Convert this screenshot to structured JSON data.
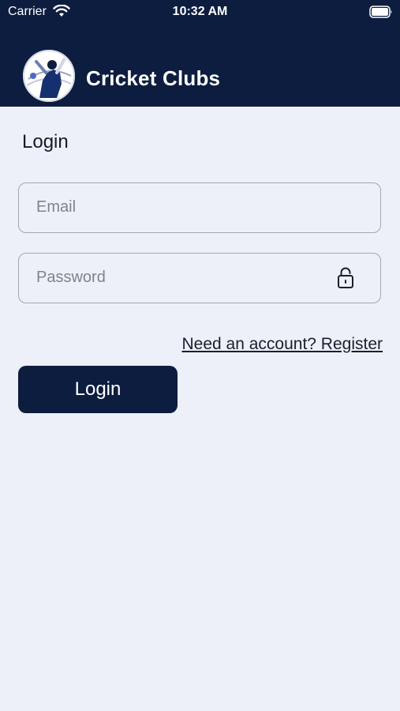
{
  "status_bar": {
    "carrier": "Carrier",
    "time": "10:32 AM",
    "wifi_icon": "wifi-icon",
    "battery_icon": "battery-icon"
  },
  "header": {
    "logo_icon": "cricket-logo",
    "title": "Cricket Clubs",
    "background_color": "#0d1d3f"
  },
  "page": {
    "section_title": "Login",
    "background_color": "#edf0f8"
  },
  "form": {
    "email": {
      "value": "",
      "placeholder": "Email"
    },
    "password": {
      "value": "",
      "placeholder": "Password",
      "toggle_icon": "lock-icon"
    },
    "register_link": "Need an account? Register",
    "login_button": "Login"
  }
}
